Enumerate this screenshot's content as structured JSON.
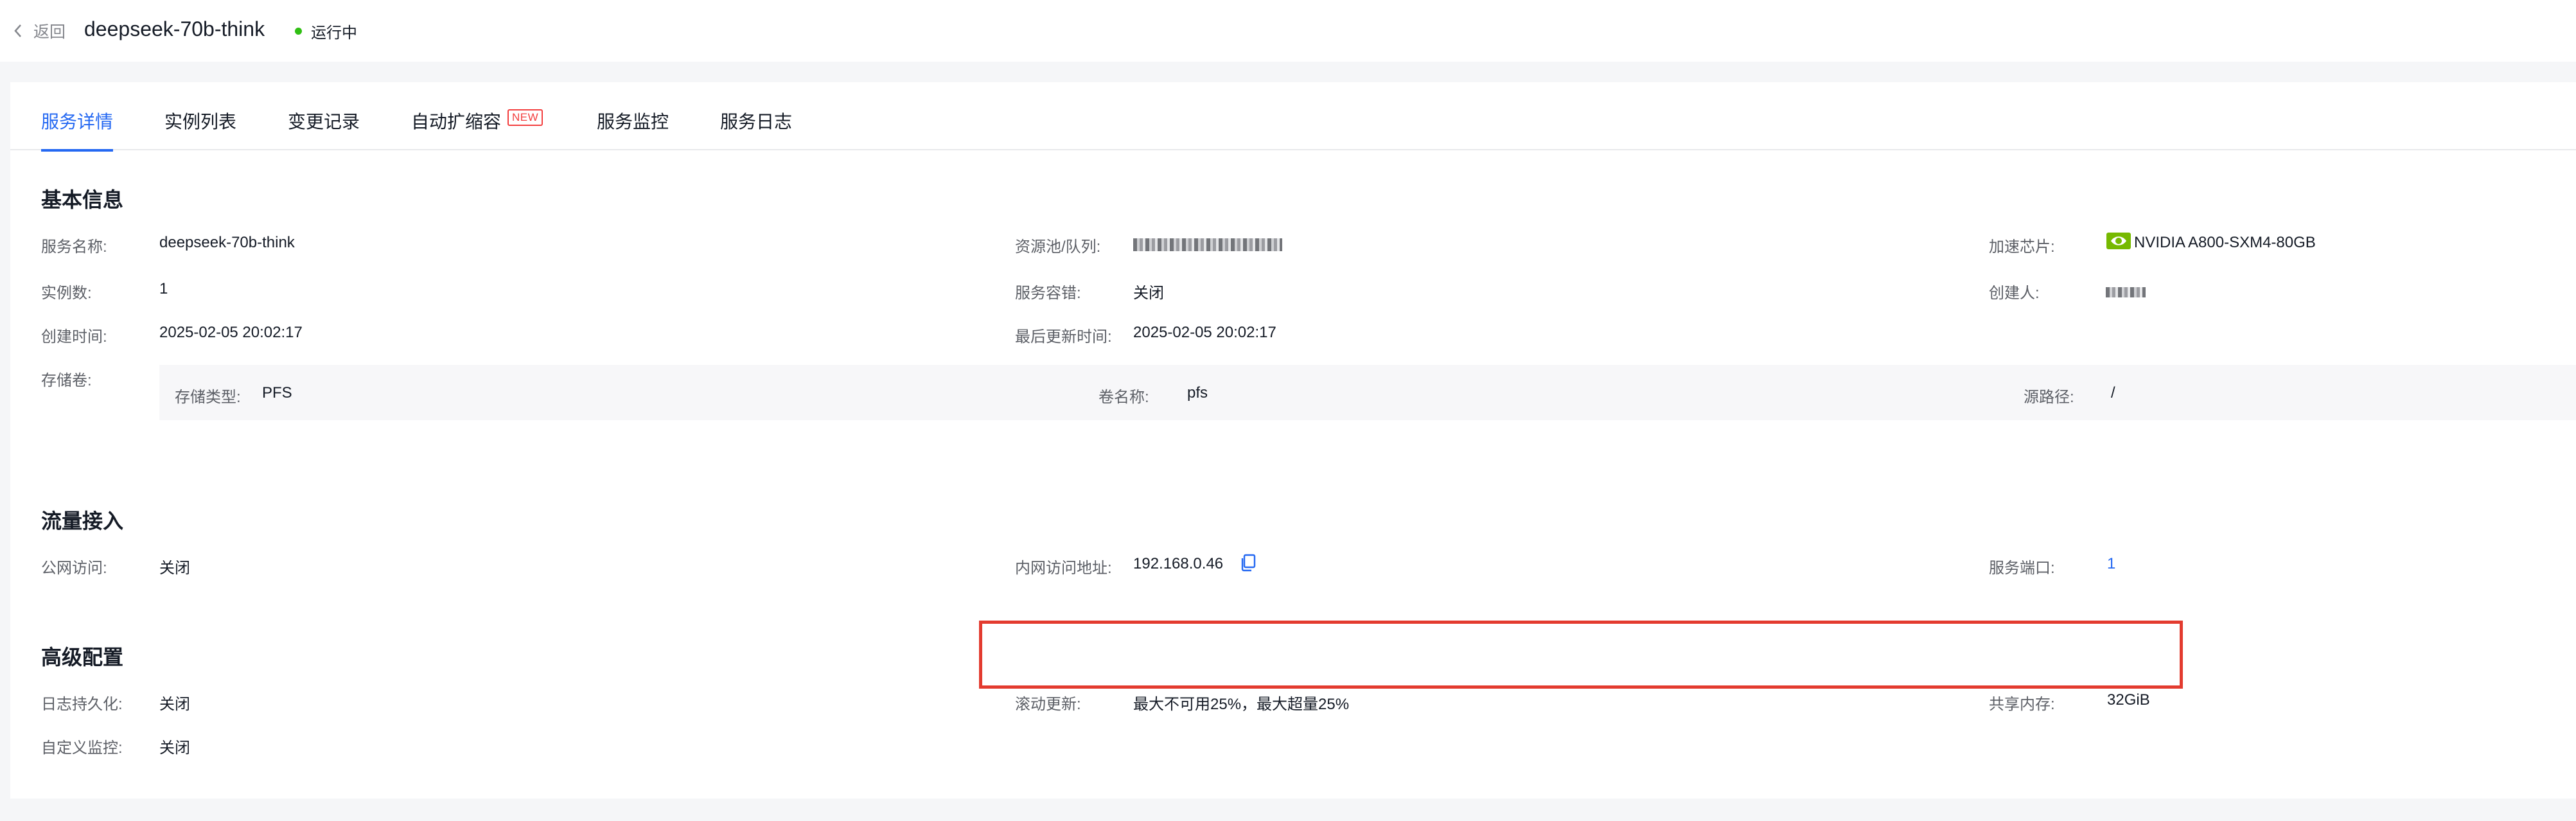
{
  "header": {
    "back_label": "返回",
    "title": "deepseek-70b-think",
    "status": "运行中",
    "status_color": "#30bf13"
  },
  "tabs": [
    {
      "label": "服务详情",
      "active": true
    },
    {
      "label": "实例列表",
      "active": false
    },
    {
      "label": "变更记录",
      "active": false
    },
    {
      "label": "自动扩缩容",
      "active": false,
      "badge": "NEW"
    },
    {
      "label": "服务监控",
      "active": false
    },
    {
      "label": "服务日志",
      "active": false
    }
  ],
  "basic": {
    "title": "基本信息",
    "service_name_label": "服务名称:",
    "service_name": "deepseek-70b-think",
    "pool_label": "资源池/队列:",
    "chip_label": "加速芯片:",
    "chip_icon": "nvidia-icon",
    "chip": "NVIDIA A800-SXM4-80GB",
    "instances_label": "实例数:",
    "instances": "1",
    "fault_tolerance_label": "服务容错:",
    "fault_tolerance": "关闭",
    "creator_label": "创建人:",
    "created_label": "创建时间:",
    "created": "2025-02-05 20:02:17",
    "updated_label": "最后更新时间:",
    "updated": "2025-02-05 20:02:17",
    "volume_label": "存储卷:",
    "volume": {
      "type_label": "存储类型:",
      "type": "PFS",
      "name_label": "卷名称:",
      "name": "pfs",
      "source_label": "源路径:",
      "source": "/"
    }
  },
  "traffic": {
    "title": "流量接入",
    "public_label": "公网访问:",
    "public": "关闭",
    "internal_label": "内网访问地址:",
    "internal": "192.168.0.46",
    "port_label": "服务端口:",
    "port": "1"
  },
  "advanced": {
    "title": "高级配置",
    "log_label": "日志持久化:",
    "log": "关闭",
    "rolling_label": "滚动更新:",
    "rolling": "最大不可用25%，最大超量25%",
    "shm_label": "共享内存:",
    "shm": "32GiB",
    "monitor_label": "自定义监控:",
    "monitor": "关闭"
  },
  "colors": {
    "accent": "#2468f2",
    "highlight": "#e33b2f",
    "badge": "#f33e3e"
  }
}
